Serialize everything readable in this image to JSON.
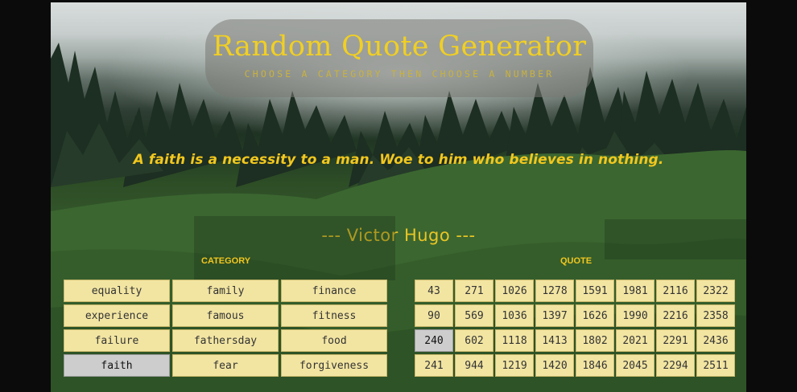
{
  "header": {
    "title": "Random Quote Generator",
    "subtitle": "CHOOSE A CATEGORY THEN CHOOSE A NUMBER"
  },
  "quote": {
    "text": "A faith is a necessity to a man. Woe to him who believes in nothing.",
    "author": "--- Victor Hugo ---"
  },
  "category_panel": {
    "heading": "CATEGORY",
    "selected": "faith",
    "items": [
      "equality",
      "family",
      "finance",
      "experience",
      "famous",
      "fitness",
      "failure",
      "fathersday",
      "food",
      "faith",
      "fear",
      "forgiveness"
    ]
  },
  "quote_panel": {
    "heading": "QUOTE",
    "selected": "240",
    "items": [
      "43",
      "271",
      "1026",
      "1278",
      "1591",
      "1981",
      "2116",
      "2322",
      "90",
      "569",
      "1036",
      "1397",
      "1626",
      "1990",
      "2216",
      "2358",
      "240",
      "602",
      "1118",
      "1413",
      "1802",
      "2021",
      "2291",
      "2436",
      "241",
      "944",
      "1219",
      "1420",
      "1846",
      "2045",
      "2294",
      "2511"
    ]
  },
  "colors": {
    "accent": "#f2c71e",
    "button_bg": "#f2e5a2",
    "button_selected_bg": "#cdcdcd"
  }
}
